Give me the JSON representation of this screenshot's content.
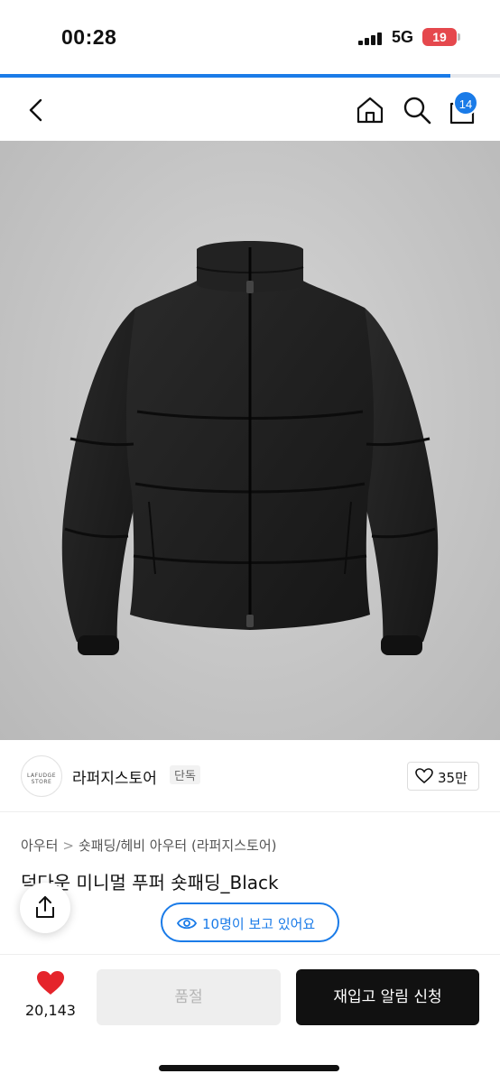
{
  "status": {
    "time": "00:28",
    "network": "5G",
    "battery": "19"
  },
  "progress_fraction": 0.9,
  "nav": {
    "cart_count": "14"
  },
  "store": {
    "name": "라퍼지스토어",
    "tag": "단독",
    "likes": "35만",
    "logo_text": "LAFUDGE STORE"
  },
  "breadcrumb": {
    "level1": "아우터",
    "separator": ">",
    "level2": "숏패딩/헤비 아우터 (라퍼지스토어)"
  },
  "product": {
    "title": "덕다운 미니멀 푸퍼 숏패딩_Black"
  },
  "viewers": {
    "text": "10명이 보고 있어요"
  },
  "bottom": {
    "heart_count": "20,143",
    "soldout_label": "품절",
    "restock_label": "재입고 알림 신청"
  },
  "colors": {
    "accent": "#1a7be8",
    "heart": "#e5242b",
    "battery": "#e5484d"
  },
  "icons": [
    "back-icon",
    "home-icon",
    "search-icon",
    "bag-icon",
    "heart-outline-icon",
    "share-icon",
    "eye-icon",
    "heart-filled-icon"
  ]
}
